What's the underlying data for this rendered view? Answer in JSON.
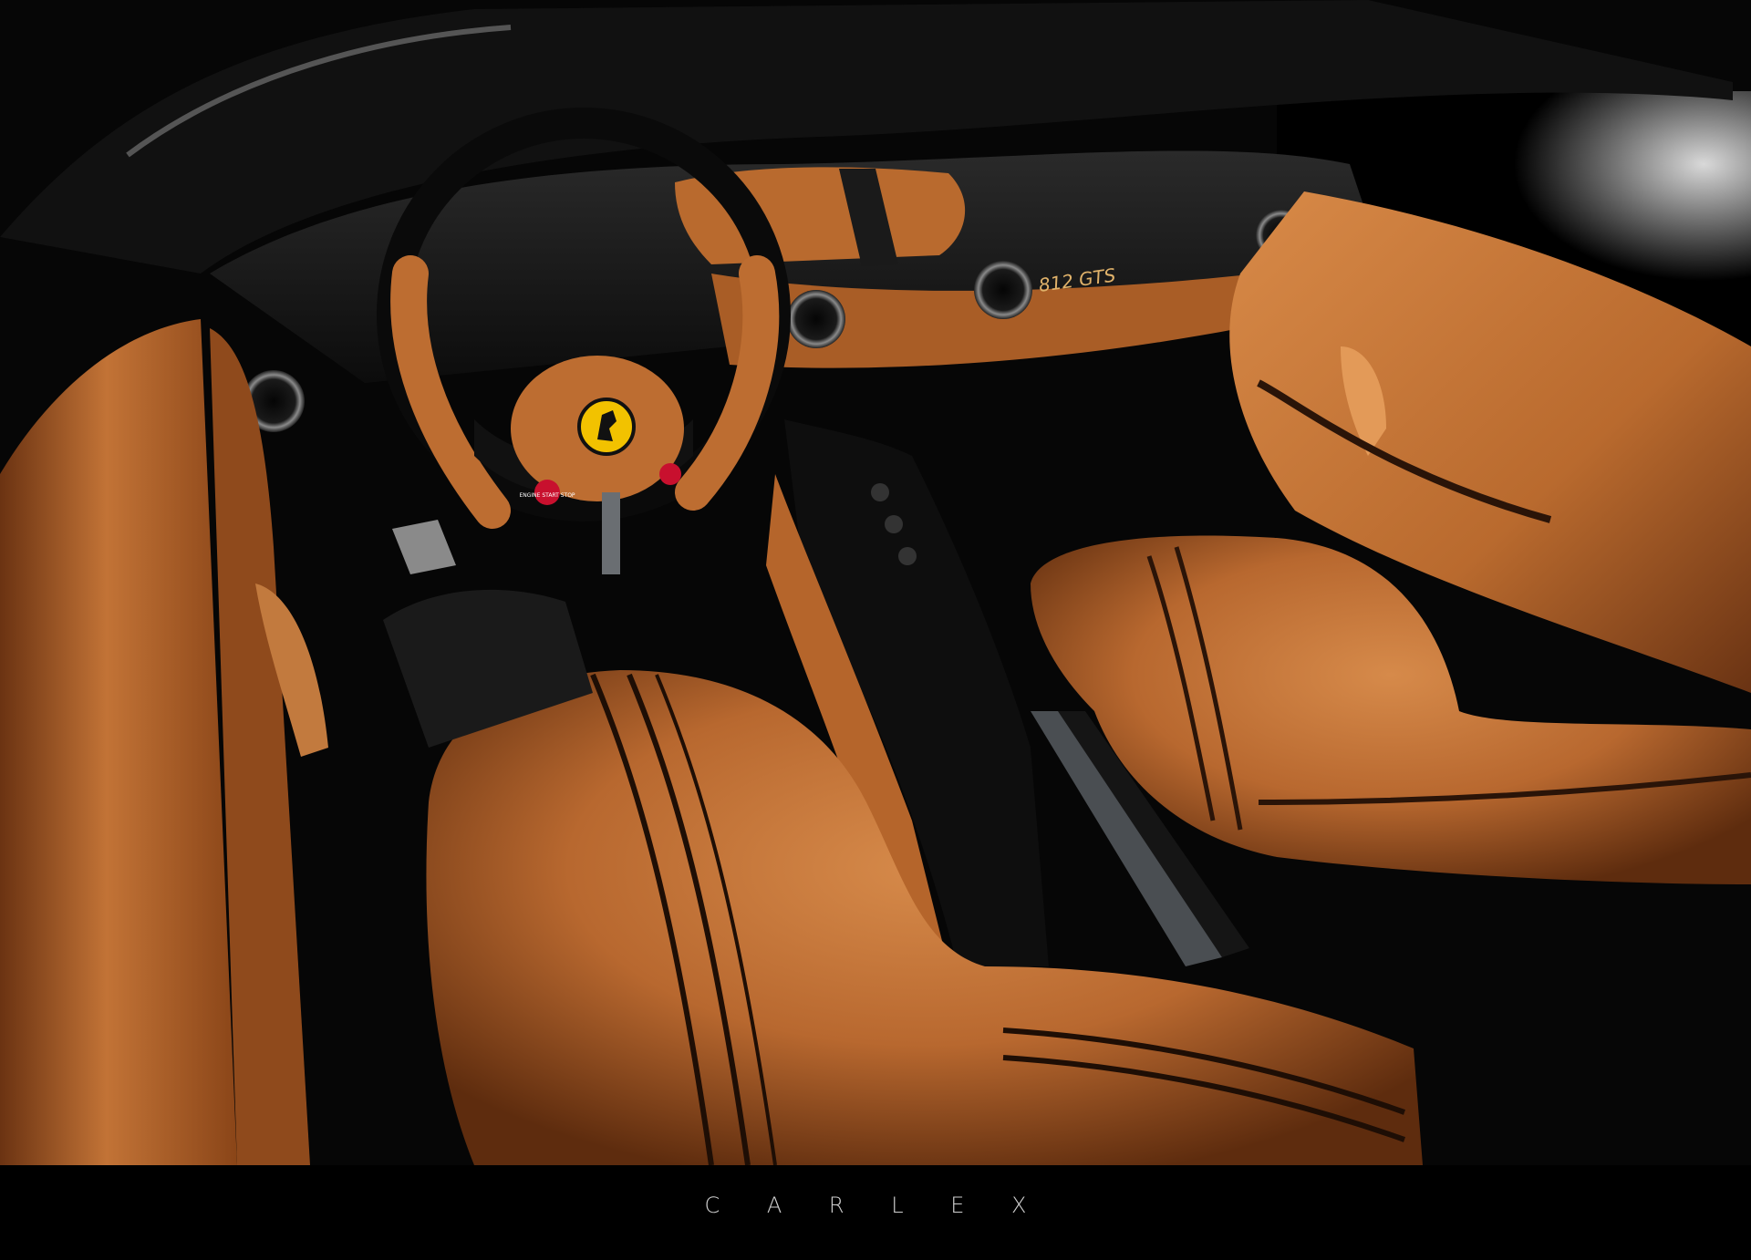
{
  "photo": {
    "subject": "car interior",
    "palette": {
      "leather": "#b8682f",
      "leather_light": "#d68a4a",
      "leather_dark": "#6d3512",
      "black": "#0b0b0b",
      "trim_gray": "#6a6e72",
      "badge_yellow": "#f2c200"
    },
    "badge_text": "812 GTS",
    "start_button_text": "ENGINE START STOP"
  },
  "footer": {
    "brand": "C A R L E X"
  }
}
